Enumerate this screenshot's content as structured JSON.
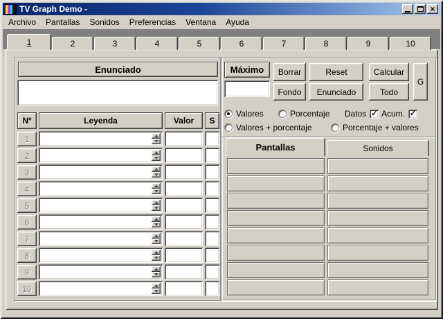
{
  "window": {
    "title": "TV Graph Demo -",
    "controls": {
      "close_glyph": "×"
    },
    "icons": {
      "app": "tv-color-bars-icon",
      "minimize": "minimize-icon",
      "maximize": "maximize-icon",
      "close": "close-icon"
    }
  },
  "menu": {
    "items": [
      "Archivo",
      "Pantallas",
      "Sonidos",
      "Preferencias",
      "Ventana",
      "Ayuda"
    ]
  },
  "tabstrip": {
    "tabs": [
      "1",
      "2",
      "3",
      "4",
      "5",
      "6",
      "7",
      "8",
      "9",
      "10"
    ],
    "active": "1"
  },
  "left_panel": {
    "enunciado_header": "Enunciado",
    "enunciado_value": "",
    "table": {
      "headers": [
        "Nº",
        "Leyenda",
        "Valor",
        "S"
      ],
      "rows": [
        {
          "num": "1",
          "leyenda": "",
          "valor": "",
          "s": ""
        },
        {
          "num": "2",
          "leyenda": "",
          "valor": "",
          "s": ""
        },
        {
          "num": "3",
          "leyenda": "",
          "valor": "",
          "s": ""
        },
        {
          "num": "4",
          "leyenda": "",
          "valor": "",
          "s": ""
        },
        {
          "num": "5",
          "leyenda": "",
          "valor": "",
          "s": ""
        },
        {
          "num": "6",
          "leyenda": "",
          "valor": "",
          "s": ""
        },
        {
          "num": "7",
          "leyenda": "",
          "valor": "",
          "s": ""
        },
        {
          "num": "8",
          "leyenda": "",
          "valor": "",
          "s": ""
        },
        {
          "num": "9",
          "leyenda": "",
          "valor": "",
          "s": ""
        },
        {
          "num": "10",
          "leyenda": "",
          "valor": "",
          "s": ""
        }
      ]
    }
  },
  "right_panel": {
    "maximo_label": "Máximo",
    "maximo_value": "",
    "buttons": {
      "borrar": "Borrar",
      "reset": "Reset",
      "calcular": "Calcular",
      "fondo": "Fondo",
      "enunciado": "Enunciado",
      "todo": "Todo",
      "g": "G"
    },
    "options": {
      "radios": [
        {
          "label": "Valores",
          "selected": true
        },
        {
          "label": "Porcentaje",
          "selected": false
        },
        {
          "label": "Valores + porcentaje",
          "selected": false
        },
        {
          "label": "Porcentaje + valores",
          "selected": false
        }
      ],
      "checkboxes": [
        {
          "label": "Datos",
          "checked": true
        },
        {
          "label": "Acum.",
          "checked": true
        }
      ],
      "check_glyph": "✓"
    },
    "subtabs": {
      "tabs": [
        "Pantallas",
        "Sonidos"
      ],
      "active": "Pantallas",
      "grid": {
        "columns": 2,
        "rows_per_column": 8
      }
    }
  },
  "colors": {
    "titlebar_start": "#0a246a",
    "titlebar_end": "#a6caf0",
    "chrome": "#d4d0c8",
    "client_strip": "#808080",
    "field_bg": "#ffffff"
  }
}
